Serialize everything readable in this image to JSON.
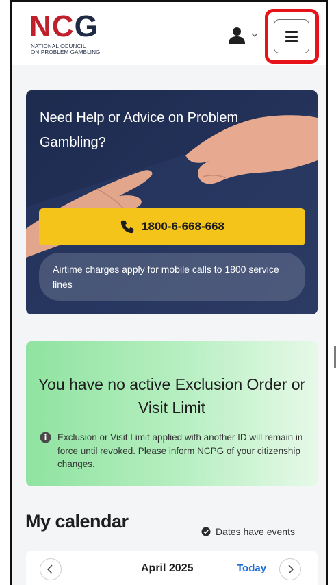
{
  "header": {
    "logo": {
      "letters_1": "N",
      "letters_2": "C",
      "letters_3": "G",
      "line1": "NATIONAL COUNCIL",
      "line2": "ON PROBLEM GAMBLING"
    },
    "icons": {
      "user": "user-icon",
      "chevron": "chevron-down-icon",
      "menu": "hamburger-menu-icon"
    }
  },
  "help": {
    "title": "Need Help or Advice on Problem Gambling?",
    "phone": "1800-6-668-668",
    "airtime_note": "Airtime charges apply for mobile calls to 1800 service lines"
  },
  "exclusion": {
    "title": "You have no active Exclusion Order or Visit Limit",
    "note": "Exclusion or Visit Limit applied with another ID will remain in force until revoked. Please inform NCPG of your citizenship changes."
  },
  "calendar": {
    "title": "My calendar",
    "legend": "Dates have events",
    "month": "April 2025",
    "today_label": "Today"
  },
  "colors": {
    "accent_yellow": "#f5c41a",
    "navy": "#1d2b4f",
    "highlight_red": "#e8121b",
    "link_blue": "#1d6fd6",
    "green": "#8fe3a0"
  }
}
